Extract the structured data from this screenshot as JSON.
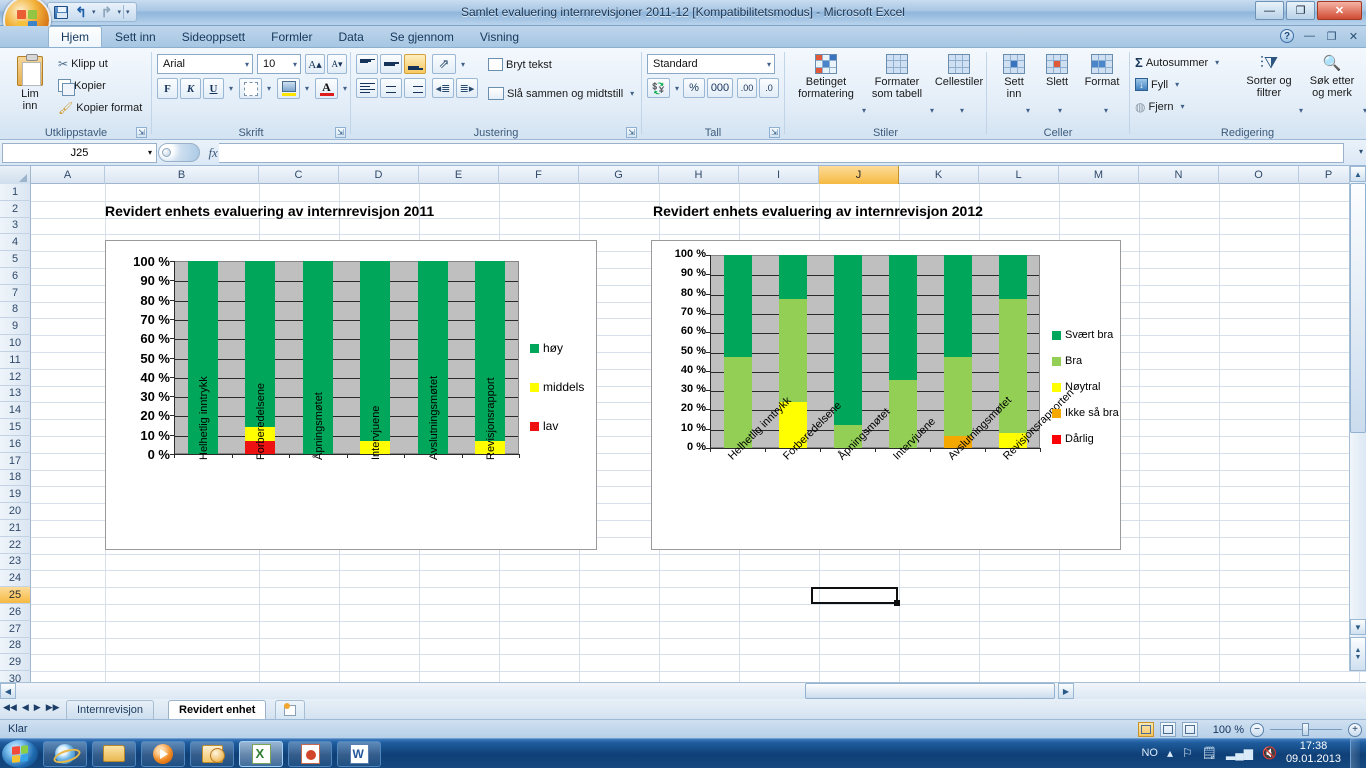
{
  "window": {
    "title": "Samlet evaluering internrevisjoner 2011-12  [Kompatibilitetsmodus] - Microsoft Excel",
    "minimize": "—",
    "restore": "❐",
    "close": "✕"
  },
  "quick_access": {
    "save_icon": "save-icon",
    "undo": "↰",
    "undo_caret": "▾",
    "redo": "↱",
    "redo_caret": "▾",
    "customize": "▾"
  },
  "ribbon": {
    "help_icon": "?",
    "minimize_ribbon": "—",
    "restore_ribbon": "❐",
    "close_ribbon": "✕",
    "tabs": [
      {
        "label": "Hjem",
        "active": true
      },
      {
        "label": "Sett inn",
        "active": false
      },
      {
        "label": "Sideoppsett",
        "active": false
      },
      {
        "label": "Formler",
        "active": false
      },
      {
        "label": "Data",
        "active": false
      },
      {
        "label": "Se gjennom",
        "active": false
      },
      {
        "label": "Visning",
        "active": false
      }
    ],
    "groups": [
      {
        "name": "Utklippstavle",
        "label": "Utklippstavle",
        "paste_label": "Lim\ninn",
        "paste_caret": "▾",
        "items": [
          {
            "label": "Klipp ut",
            "icon": "scissors-icon"
          },
          {
            "label": "Kopier",
            "icon": "copy-icon"
          },
          {
            "label": "Kopier format",
            "icon": "format-painter-icon"
          }
        ]
      },
      {
        "name": "Skrift",
        "label": "Skrift",
        "font_name": "Arial",
        "font_size": "10",
        "grow_font": "A▴",
        "shrink_font": "A▾",
        "bold": "F",
        "italic": "K",
        "underline": "U",
        "borders_icon": "borders-icon",
        "fill_icon": "fill-color-icon",
        "fontcolor_icon": "font-color-icon",
        "fill_color": "#ffe400",
        "font_color": "#e01b1b"
      },
      {
        "name": "Justering",
        "label": "Justering",
        "wrap_text": "Bryt tekst",
        "merge_center": "Slå sammen og midtstill",
        "merge_caret": "▾",
        "orientation_icon": "text-orientation-icon"
      },
      {
        "name": "Tall",
        "label": "Tall",
        "number_format": "Standard",
        "currency_icon": "currency-icon",
        "percent": "%",
        "thousands": "000",
        "inc_dec": "increase-decimal-icon",
        "dec_dec": "decrease-decimal-icon"
      },
      {
        "name": "Stiler",
        "label": "Stiler",
        "items": [
          {
            "label": "Betinget\nformatering",
            "caret": "▾",
            "icon": "conditional-formatting-icon"
          },
          {
            "label": "Formater\nsom tabell",
            "caret": "▾",
            "icon": "format-as-table-icon"
          },
          {
            "label": "Cellestiler",
            "caret": "▾",
            "icon": "cell-styles-icon"
          }
        ]
      },
      {
        "name": "Celler",
        "label": "Celler",
        "items": [
          {
            "label": "Sett\ninn",
            "caret": "▾",
            "icon": "insert-cells-icon"
          },
          {
            "label": "Slett",
            "caret": "▾",
            "icon": "delete-cells-icon"
          },
          {
            "label": "Format",
            "caret": "▾",
            "icon": "format-cells-icon"
          }
        ]
      },
      {
        "name": "Redigering",
        "label": "Redigering",
        "items": [
          {
            "label": "Autosummer",
            "caret": "▾",
            "icon": "autosum-icon"
          },
          {
            "label": "Fyll",
            "caret": "▾",
            "icon": "fill-down-icon"
          },
          {
            "label": "Fjern",
            "caret": "▾",
            "icon": "clear-icon"
          }
        ],
        "big_items": [
          {
            "label": "Sorter og\nfiltrer",
            "caret": "▾",
            "icon": "sort-filter-icon"
          },
          {
            "label": "Søk etter\nog merk",
            "caret": "▾",
            "icon": "find-select-icon"
          }
        ]
      }
    ]
  },
  "formula_bar": {
    "name_box": "J25",
    "name_box_caret": "▾",
    "fx_label": "fx",
    "formula_value": "",
    "expand_caret": "▾"
  },
  "grid": {
    "columns": [
      "A",
      "B",
      "C",
      "D",
      "E",
      "F",
      "G",
      "H",
      "I",
      "J",
      "K",
      "L",
      "M",
      "N",
      "O",
      "P"
    ],
    "selected_column": "J",
    "rows": [
      "1",
      "2",
      "3",
      "4",
      "5",
      "6",
      "7",
      "8",
      "9",
      "10",
      "11",
      "12",
      "13",
      "14",
      "15",
      "16",
      "17",
      "18",
      "19",
      "20",
      "21",
      "22",
      "23",
      "24",
      "25",
      "26",
      "27",
      "28",
      "29",
      "30"
    ],
    "selected_row": "25",
    "selected_cell": "J25"
  },
  "chart_data": [
    {
      "type": "bar",
      "subtype": "stacked-100-percent",
      "title": "Revidert enhets evaluering av internrevisjon 2011",
      "xlabel": "",
      "ylabel": "",
      "ylim": [
        0,
        100
      ],
      "ytick_labels": [
        "100 %",
        "90 %",
        "80 %",
        "70 %",
        "60 %",
        "50 %",
        "40 %",
        "30 %",
        "20 %",
        "10 %",
        "0 %"
      ],
      "grid": true,
      "plot_background": "#bfbfbf",
      "legend_position": "right",
      "categories": [
        "Helhetlig inntrykk",
        "Forberedelsene",
        "Åpningsmøtet",
        "Intervjuene",
        "Avslutningsmøtet",
        "Revisjonsrapport"
      ],
      "series": [
        {
          "name": "lav",
          "color": "#ee1111",
          "values": [
            0,
            7,
            0,
            0,
            0,
            0
          ]
        },
        {
          "name": "middels",
          "color": "#ffff00",
          "values": [
            0,
            7,
            0,
            7,
            0,
            7
          ]
        },
        {
          "name": "høy",
          "color": "#00a65a",
          "values": [
            100,
            86,
            100,
            93,
            100,
            93
          ]
        }
      ],
      "legend_order": [
        "høy",
        "middels",
        "lav"
      ]
    },
    {
      "type": "bar",
      "subtype": "stacked-100-percent",
      "title": "Revidert enhets evaluering av internrevisjon 2012",
      "xlabel": "",
      "ylabel": "",
      "ylim": [
        0,
        100
      ],
      "ytick_labels": [
        "100 %",
        "90 %",
        "80 %",
        "70 %",
        "60 %",
        "50 %",
        "40 %",
        "30 %",
        "20 %",
        "10 %",
        "0 %"
      ],
      "grid": true,
      "plot_background": "#d0d0d0",
      "legend_position": "right",
      "categories": [
        "Helhetlig inntrykk",
        "Forberedelsene",
        "Åpningsmøtet",
        "Intervjuene",
        "Avslutningsmøtet",
        "Revisjonsrapporten"
      ],
      "series": [
        {
          "name": "Dårlig",
          "color": "#ff0000",
          "values": [
            0,
            0,
            0,
            0,
            0,
            0
          ]
        },
        {
          "name": "Ikke så bra",
          "color": "#f5a800",
          "values": [
            0,
            0,
            0,
            0,
            6,
            0
          ]
        },
        {
          "name": "Nøytral",
          "color": "#ffff00",
          "values": [
            0,
            24,
            0,
            0,
            0,
            8
          ]
        },
        {
          "name": "Bra",
          "color": "#92cf54",
          "values": [
            47,
            53,
            12,
            35,
            41,
            69
          ]
        },
        {
          "name": "Svært bra",
          "color": "#00a65a",
          "values": [
            53,
            23,
            88,
            65,
            53,
            23
          ]
        }
      ],
      "legend_order": [
        "Svært bra",
        "Bra",
        "Nøytral",
        "Ikke så bra",
        "Dårlig"
      ]
    }
  ],
  "sheet_tabs": {
    "nav": {
      "first": "◀◀",
      "prev": "◀",
      "next": "▶",
      "last": "▶▶"
    },
    "tabs": [
      {
        "label": "Internrevisjon",
        "active": false
      },
      {
        "label": "Revidert enhet",
        "active": true
      }
    ],
    "new_sheet_icon": "new-sheet-icon"
  },
  "status_bar": {
    "status": "Klar",
    "zoom_label": "100 %",
    "zoom_out": "−",
    "zoom_in": "+",
    "views": [
      "normal-view-icon",
      "page-layout-view-icon",
      "page-break-view-icon"
    ]
  },
  "taskbar": {
    "start_icon": "windows-start-icon",
    "buttons": [
      {
        "icon": "internet-explorer-icon",
        "active": false
      },
      {
        "icon": "explorer-folder-icon",
        "active": false
      },
      {
        "icon": "windows-media-player-icon",
        "active": false
      },
      {
        "icon": "outlook-icon",
        "active": false
      },
      {
        "icon": "excel-icon",
        "active": true
      },
      {
        "icon": "powerpoint-icon",
        "active": false
      },
      {
        "icon": "word-icon",
        "active": false
      }
    ],
    "tray": {
      "language": "NO",
      "show_hidden": "▴",
      "icons": [
        "network-flag-icon",
        "action-center-icon",
        "network-signal-icon",
        "volume-muted-icon"
      ],
      "time": "17:38",
      "date": "09.01.2013"
    }
  }
}
